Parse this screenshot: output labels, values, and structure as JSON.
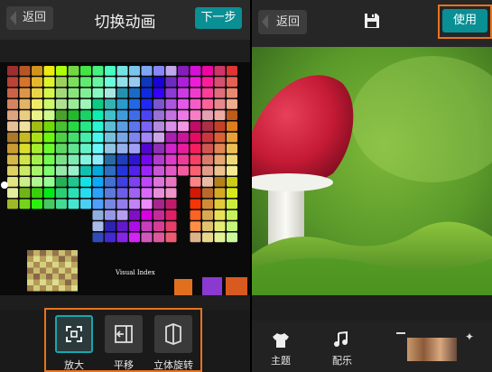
{
  "left": {
    "back": "返回",
    "title": "切换动画",
    "next": "下一步",
    "image_caption": "Visual Index",
    "animations": [
      {
        "label": "放大",
        "selected": true
      },
      {
        "label": "平移",
        "selected": false
      },
      {
        "label": "立体旋转",
        "selected": false
      }
    ]
  },
  "right": {
    "back": "返回",
    "use": "使用",
    "nav": [
      {
        "label": "主题"
      },
      {
        "label": "配乐"
      }
    ]
  },
  "colors": {
    "accent": "#0a8f94",
    "highlight": "#e8731e"
  }
}
